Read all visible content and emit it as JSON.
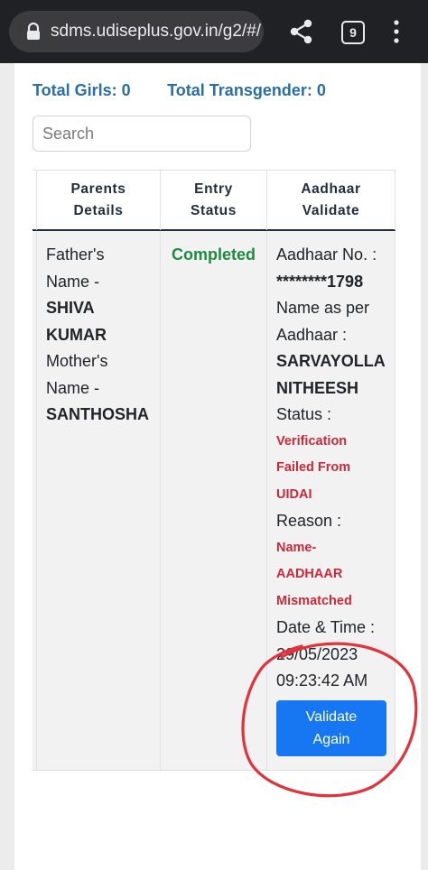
{
  "browser": {
    "url": "sdms.udiseplus.gov.in/g2/#/",
    "tab_count": "9",
    "lock_icon": "lock-icon",
    "share_icon": "share-icon",
    "menu_icon": "more-vert-icon"
  },
  "summary": {
    "total_girls": "Total Girls: 0",
    "total_transgender": "Total Transgender: 0"
  },
  "search": {
    "placeholder": "Search"
  },
  "table": {
    "headers": {
      "parents_line1": "Parents",
      "parents_line2": "Details",
      "entry_line1": "Entry",
      "entry_line2": "Status",
      "aadhaar_line1": "Aadhaar",
      "aadhaar_line2": "Validate"
    },
    "row": {
      "parents": {
        "father_label1": "Father's",
        "father_label2": "Name -",
        "father_name1": "SHIVA",
        "father_name2": "KUMAR",
        "mother_label1": "Mother's",
        "mother_label2": "Name -",
        "mother_name": "SANTHOSHA"
      },
      "entry_status": "Completed",
      "aadhaar": {
        "no_label": "Aadhaar No. :",
        "no_value": "********1798",
        "name_label1": "Name as per",
        "name_label2": "Aadhaar :",
        "name_value1": "SARVAYOLLA",
        "name_value2": "NITHEESH",
        "status_label": "Status :",
        "status_value1": "Verification",
        "status_value2": "Failed From",
        "status_value3": "UIDAI",
        "reason_label": "Reason :",
        "reason_value1": "Name-",
        "reason_value2": "AADHAAR",
        "reason_value3": "Mismatched",
        "datetime_label": "Date & Time :",
        "date_value": "29/05/2023",
        "time_value": "09:23:42 AM",
        "button_line1": "Validate",
        "button_line2": "Again"
      }
    }
  },
  "colors": {
    "accent_blue": "#2b6ea5",
    "button_blue": "#1777f2",
    "success_green": "#1f8a44",
    "error_red": "#c62b3c",
    "annotation_red": "#e0333c"
  }
}
